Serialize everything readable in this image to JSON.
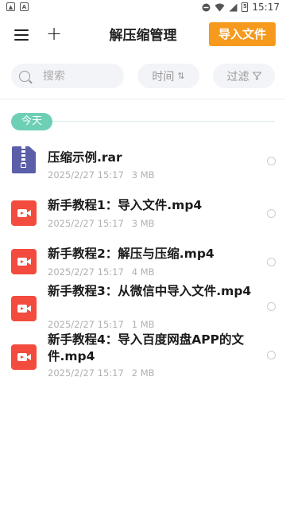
{
  "status_bar": {
    "time": "15:17",
    "battery": "5"
  },
  "header": {
    "title": "解压缩管理",
    "import_label": "导入文件"
  },
  "filters": {
    "search_placeholder": "搜索",
    "sort_label": "时间",
    "filter_label": "过滤"
  },
  "section": {
    "label": "今天"
  },
  "files": [
    {
      "name": "压缩示例.rar",
      "date": "2025/2/27 15:17",
      "size": "3 MB",
      "type": "rar"
    },
    {
      "name": "新手教程1：导入文件.mp4",
      "date": "2025/2/27 15:17",
      "size": "3 MB",
      "type": "mp4"
    },
    {
      "name": "新手教程2：解压与压缩.mp4",
      "date": "2025/2/27 15:17",
      "size": "4 MB",
      "type": "mp4"
    },
    {
      "name": "新手教程3：从微信中导入文件.mp4",
      "date": "2025/2/27 15:17",
      "size": "1 MB",
      "type": "mp4"
    },
    {
      "name": "新手教程4：导入百度网盘APP的文件.mp4",
      "date": "2025/2/27 15:17",
      "size": "2 MB",
      "type": "mp4"
    }
  ],
  "colors": {
    "accent": "#f59a1c",
    "today_badge": "#6ecfb7",
    "video_icon": "#f34b3e",
    "archive_icon": "#5b5ea8"
  }
}
